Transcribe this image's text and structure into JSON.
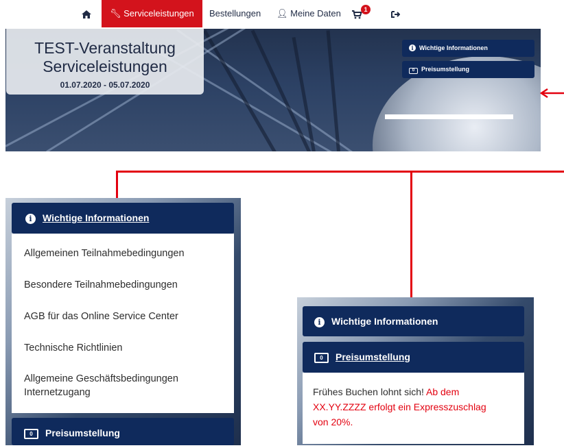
{
  "nav": {
    "service_label": "Serviceleistungen",
    "orders_label": "Bestellungen",
    "mydata_label": "Meine Daten",
    "cart_count": "1"
  },
  "hero": {
    "title_line1": "TEST-Veranstaltung",
    "title_line2": "Serviceleistungen",
    "date": "01.07.2020 - 05.07.2020",
    "btn_info": "Wichtige Informationen",
    "btn_price": "Preisumstellung"
  },
  "left_panel": {
    "header": "Wichtige Informationen",
    "links": [
      "Allgemeinen Teilnahmebedingungen",
      "Besondere Teilnahmebedingungen",
      "AGB für das Online Service Center",
      "Technische Richtlinien",
      "Allgemeine Geschäftsbedingungen",
      "Internetzugang"
    ],
    "footer_header": "Preisumstellung"
  },
  "right_panel": {
    "header_info": "Wichtige Informationen",
    "header_price": "Preisumstellung",
    "text_black": "Frühes Buchen lohnt sich!",
    "text_red_1": "Ab dem",
    "text_red_2": "XX.YY.ZZZZ erfolgt ein Expresszuschlag",
    "text_red_3": "von 20%."
  },
  "colors": {
    "accent_red": "#d3131c",
    "navy": "#0f2a5c",
    "annotation_red": "#e3000f"
  }
}
